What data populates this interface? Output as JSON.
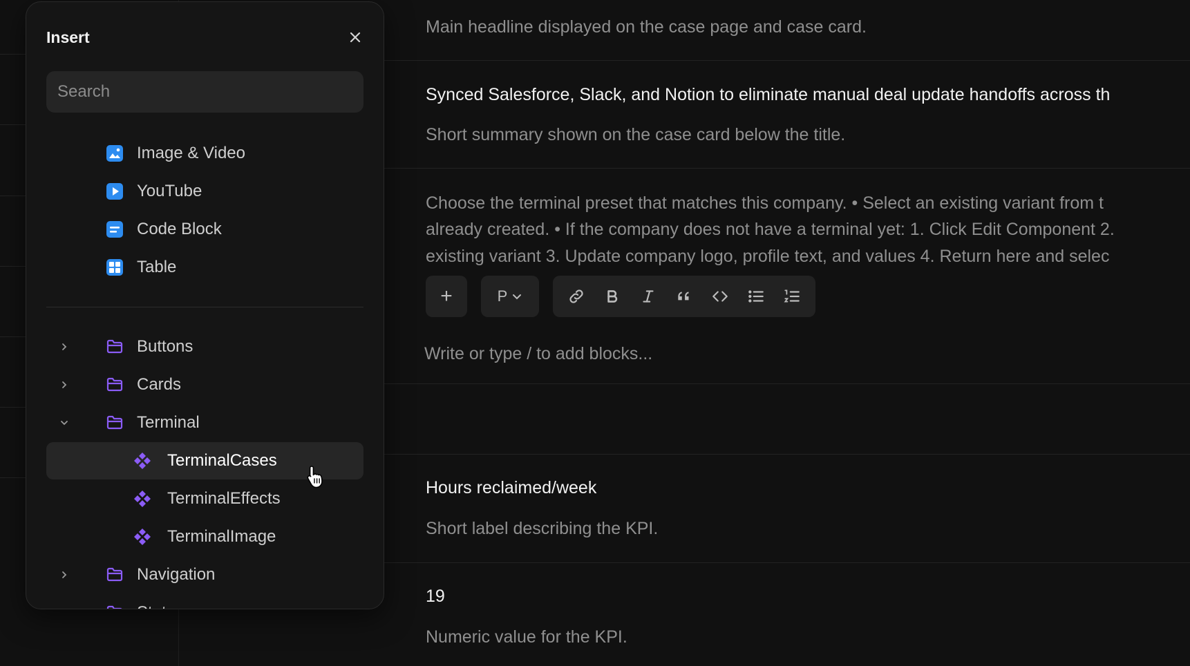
{
  "insert_panel": {
    "title": "Insert",
    "search_placeholder": "Search",
    "blocks": [
      {
        "label": "Image & Video",
        "icon": "image-icon"
      },
      {
        "label": "YouTube",
        "icon": "youtube-play-icon"
      },
      {
        "label": "Code Block",
        "icon": "code-block-icon"
      },
      {
        "label": "Table",
        "icon": "table-icon"
      }
    ],
    "folders": [
      {
        "label": "Buttons",
        "expanded": false
      },
      {
        "label": "Cards",
        "expanded": false
      },
      {
        "label": "Terminal",
        "expanded": true,
        "children": [
          {
            "label": "TerminalCases",
            "active": true
          },
          {
            "label": "TerminalEffects",
            "active": false
          },
          {
            "label": "TerminalImage",
            "active": false
          }
        ]
      },
      {
        "label": "Navigation",
        "expanded": false
      },
      {
        "label": "Stats",
        "expanded": false
      }
    ],
    "colors": {
      "block_icon": "#2d8cf0",
      "folder_icon": "#8b5cf6",
      "component_icon": "#8b5cf6"
    }
  },
  "editor": {
    "title_hint": "Main headline displayed on the case page and case card.",
    "summary_value": "Synced Salesforce, Slack, and Notion to eliminate manual deal update handoffs across th",
    "summary_hint": "Short summary shown on the case card below the title.",
    "terminal_help_lines": [
      "Choose the terminal preset that matches this company. • Select an existing variant from t",
      "already created. • If the company does not have a terminal yet: 1. Click Edit Component 2.",
      "existing variant 3. Update company logo, profile text, and values 4. Return here and selec"
    ],
    "toolbar": {
      "add_label": "+",
      "paragraph_label": "P"
    },
    "editor_placeholder": "Write or type / to add blocks...",
    "kpi_label_value": "Hours reclaimed/week",
    "kpi_label_hint": "Short label describing the KPI.",
    "kpi_value": "19",
    "kpi_value_hint": "Numeric value for the KPI."
  }
}
